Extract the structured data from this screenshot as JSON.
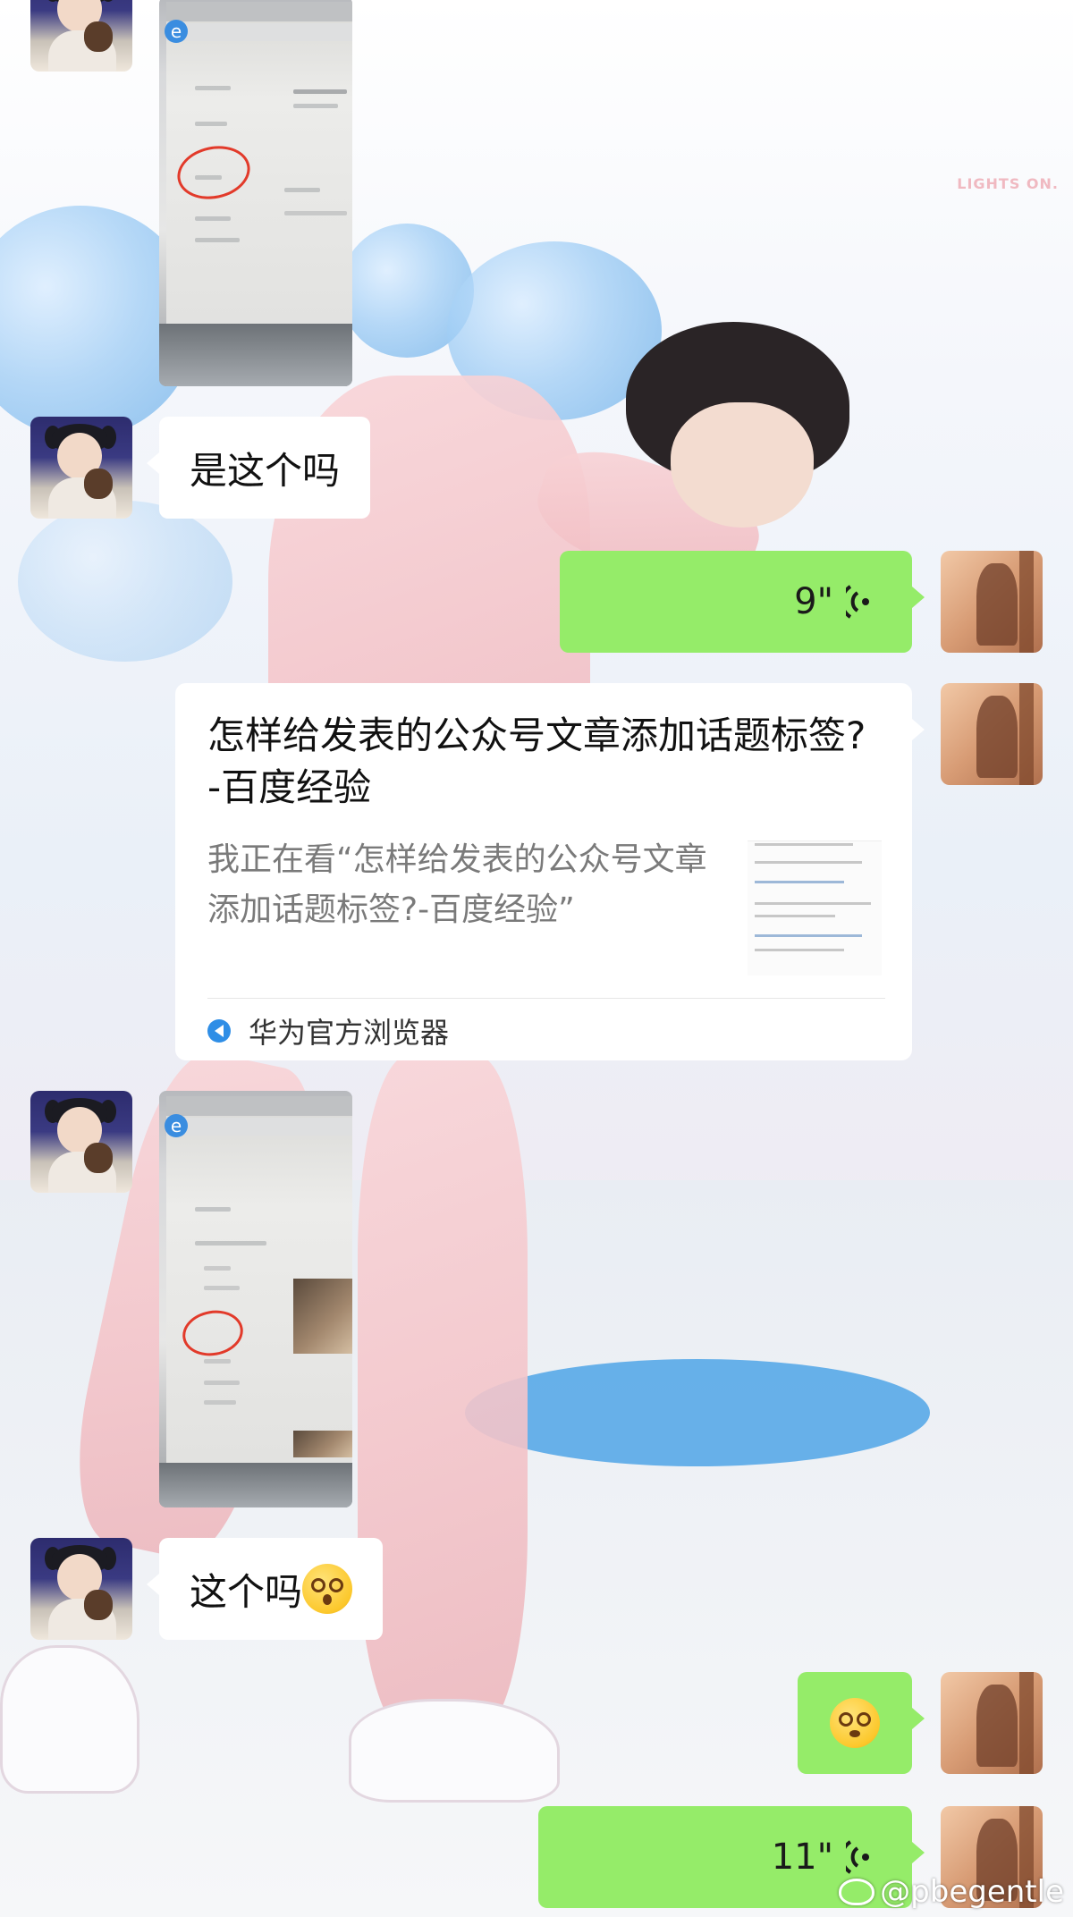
{
  "wallpaper": {
    "brand_text": "LIGHTS ON."
  },
  "messages": [
    {
      "id": "m1",
      "side": "left",
      "type": "image",
      "avatar": "child-avatar",
      "content": "browser-screenshot"
    },
    {
      "id": "m2",
      "side": "left",
      "type": "text",
      "avatar": "child-avatar",
      "text": "是这个吗"
    },
    {
      "id": "m3",
      "side": "right",
      "type": "voice",
      "avatar": "shadow-avatar",
      "duration": "9\""
    },
    {
      "id": "m4",
      "side": "right",
      "type": "link-card",
      "avatar": "shadow-avatar",
      "title": "怎样给发表的公众号文章添加话题标签?-百度经验",
      "description": "我正在看“怎样给发表的公众号文章添加话题标签?-百度经验”",
      "source": "华为官方浏览器"
    },
    {
      "id": "m5",
      "side": "left",
      "type": "image",
      "avatar": "child-avatar",
      "content": "browser-screenshot"
    },
    {
      "id": "m6",
      "side": "left",
      "type": "text",
      "avatar": "child-avatar",
      "text": "这个吗",
      "emoji": "shocked-face"
    },
    {
      "id": "m7",
      "side": "right",
      "type": "emoji",
      "avatar": "shadow-avatar",
      "emoji": "dizzy-face"
    },
    {
      "id": "m8",
      "side": "right",
      "type": "voice",
      "avatar": "shadow-avatar",
      "duration": "11\""
    }
  ],
  "watermark": "@pbegentle",
  "colors": {
    "sent_bubble": "#95ec69",
    "received_bubble": "#ffffff",
    "circle_annotation": "#e23a2a",
    "source_icon": "#2f8ee6"
  }
}
